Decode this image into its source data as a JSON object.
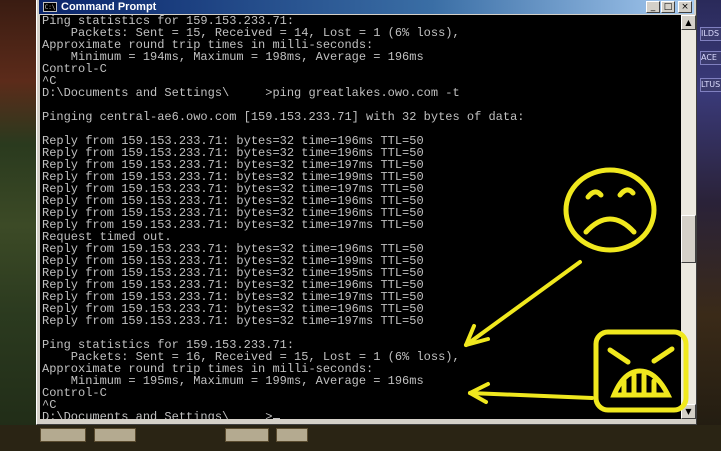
{
  "window": {
    "title": "Command Prompt",
    "icon_text": "C:\\"
  },
  "controls": {
    "minimize": "_",
    "maximize": "□",
    "close": "×"
  },
  "console_lines": [
    "Ping statistics for 159.153.233.71:",
    "    Packets: Sent = 15, Received = 14, Lost = 1 (6% loss),",
    "Approximate round trip times in milli-seconds:",
    "    Minimum = 194ms, Maximum = 198ms, Average = 196ms",
    "Control-C",
    "^C",
    "D:\\Documents and Settings\\     >ping greatlakes.owo.com -t",
    "",
    "Pinging central-ae6.owo.com [159.153.233.71] with 32 bytes of data:",
    "",
    "Reply from 159.153.233.71: bytes=32 time=196ms TTL=50",
    "Reply from 159.153.233.71: bytes=32 time=196ms TTL=50",
    "Reply from 159.153.233.71: bytes=32 time=197ms TTL=50",
    "Reply from 159.153.233.71: bytes=32 time=199ms TTL=50",
    "Reply from 159.153.233.71: bytes=32 time=197ms TTL=50",
    "Reply from 159.153.233.71: bytes=32 time=196ms TTL=50",
    "Reply from 159.153.233.71: bytes=32 time=196ms TTL=50",
    "Reply from 159.153.233.71: bytes=32 time=197ms TTL=50",
    "Request timed out.",
    "Reply from 159.153.233.71: bytes=32 time=196ms TTL=50",
    "Reply from 159.153.233.71: bytes=32 time=199ms TTL=50",
    "Reply from 159.153.233.71: bytes=32 time=195ms TTL=50",
    "Reply from 159.153.233.71: bytes=32 time=196ms TTL=50",
    "Reply from 159.153.233.71: bytes=32 time=197ms TTL=50",
    "Reply from 159.153.233.71: bytes=32 time=196ms TTL=50",
    "Reply from 159.153.233.71: bytes=32 time=197ms TTL=50",
    "",
    "Ping statistics for 159.153.233.71:",
    "    Packets: Sent = 16, Received = 15, Lost = 1 (6% loss),",
    "Approximate round trip times in milli-seconds:",
    "    Minimum = 195ms, Maximum = 199ms, Average = 196ms",
    "Control-C",
    "^C",
    "D:\\Documents and Settings\\     >"
  ],
  "background_fragments": {
    "right_tags": [
      "ILDS",
      "ACE",
      "LTUS"
    ],
    "bottom_buttons": [
      "",
      "",
      "",
      ""
    ]
  },
  "colors": {
    "console_bg": "#000000",
    "console_text": "#c0c0c0",
    "annotation": "#f0e81e"
  },
  "annotations": {
    "sad_face_icon": "sad-face",
    "angry_face_icon": "angry-face"
  }
}
